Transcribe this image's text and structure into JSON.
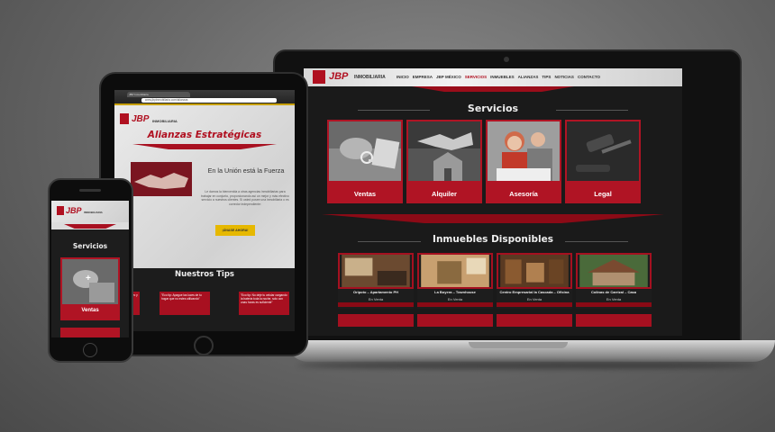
{
  "laptop": {
    "brand": "JBP",
    "brand_sub": "INMOBILIARIA",
    "nav": [
      "INICIO",
      "EMPRESA",
      "JBP MÉXICO",
      "SERVICIOS",
      "INMUEBLES",
      "ALIANZAS",
      "TIPS",
      "NOTICIAS",
      "CONTACTO"
    ],
    "services_title": "Servicios",
    "services": [
      {
        "label": "Ventas",
        "icon": "keys-hand-photo"
      },
      {
        "label": "Alquiler",
        "icon": "handshake-house-photo"
      },
      {
        "label": "Asesoría",
        "icon": "consulting-couple-photo"
      },
      {
        "label": "Legal",
        "icon": "gavel-photo"
      }
    ],
    "properties_title": "Inmuebles Disponibles",
    "properties": [
      {
        "name": "Oripoto – Apartamento PH",
        "status": "En Venta"
      },
      {
        "name": "La Boyera – Townhouse",
        "status": "En Venta"
      },
      {
        "name": "Centro Empresarial la Cascada – Oficina",
        "status": "En Venta"
      },
      {
        "name": "Colinas de Carrizal – Casa",
        "status": "En Venta"
      }
    ]
  },
  "tablet": {
    "tab_title": "JBP Inmobiliaria",
    "url": "www.jbpinmobiliaria.com/alianzas",
    "brand": "JBP",
    "brand_sub": "INMOBILIARIA",
    "heading": "Alianzas Estratégicas",
    "tagline": "En la Unión está la Fuerza",
    "body": "Le damos la bienvenida a otras agencias inmobiliarias para trabajar en conjunto, proporcionando así un mejor y más efectivo servicio a nuestros clientes. Si usted posee una inmobiliaria o es corredor independiente:",
    "cta": "¡ÚNASE AHORA!",
    "tips_title": "Nuestros Tips",
    "tips": [
      "Cierre el activo y cuando sa...",
      "\"Eco tip: Apague las luces de tu hogar que no estes utilizando\"",
      "\"Eco tip: No deje tu celular cargando la batería toda la noche, solo con unas horas es suficiente\""
    ]
  },
  "phone": {
    "brand": "JBP",
    "brand_sub": "INMOBILIARIA",
    "section_title": "Servicios",
    "service_label": "Ventas"
  }
}
